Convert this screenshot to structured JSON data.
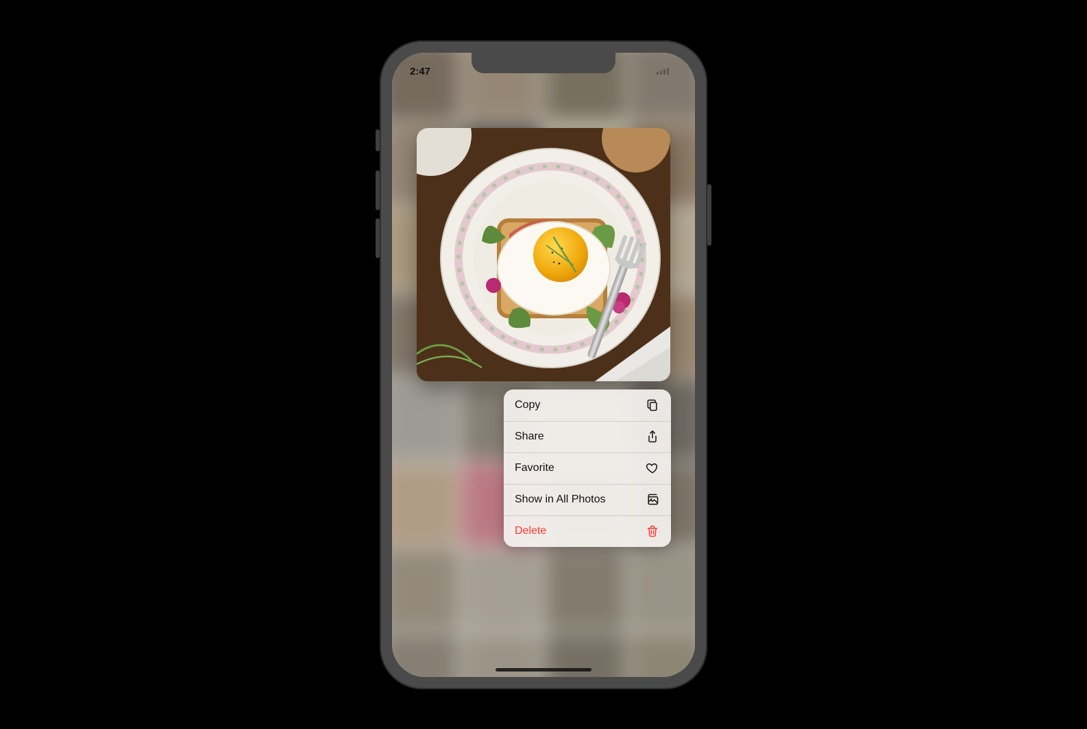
{
  "statusbar": {
    "time": "2:47"
  },
  "preview": {
    "description": "plate with fried egg on toast"
  },
  "menu": {
    "items": [
      {
        "label": "Copy",
        "icon": "copy-icon",
        "destructive": false
      },
      {
        "label": "Share",
        "icon": "share-icon",
        "destructive": false
      },
      {
        "label": "Favorite",
        "icon": "heart-icon",
        "destructive": false
      },
      {
        "label": "Show in All Photos",
        "icon": "photos-icon",
        "destructive": false
      },
      {
        "label": "Delete",
        "icon": "trash-icon",
        "destructive": true
      }
    ]
  },
  "colors": {
    "destructive": "#ff3b30"
  }
}
